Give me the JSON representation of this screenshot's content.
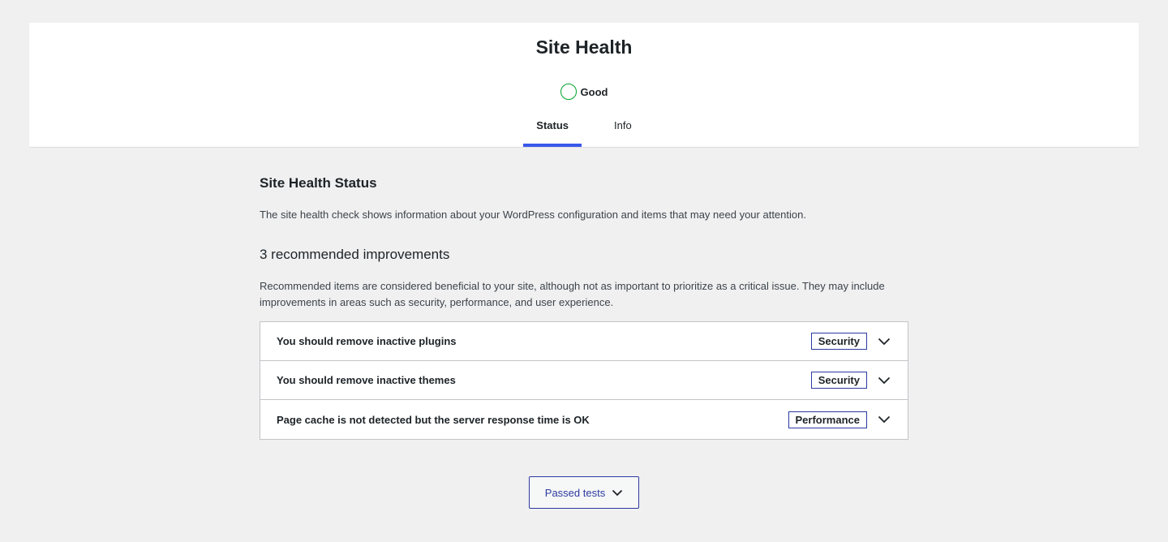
{
  "header": {
    "title": "Site Health",
    "status_label": "Good",
    "tabs": [
      {
        "label": "Status",
        "active": true
      },
      {
        "label": "Info",
        "active": false
      }
    ]
  },
  "status_section": {
    "title": "Site Health Status",
    "description": "The site health check shows information about your WordPress configuration and items that may need your attention."
  },
  "improvements": {
    "heading": "3 recommended improvements",
    "description": "Recommended items are considered beneficial to your site, although not as important to prioritize as a critical issue. They may include improvements in areas such as security, performance, and user experience.",
    "items": [
      {
        "title": "You should remove inactive plugins",
        "badge": "Security"
      },
      {
        "title": "You should remove inactive themes",
        "badge": "Security"
      },
      {
        "title": "Page cache is not detected but the server response time is OK",
        "badge": "Performance"
      }
    ]
  },
  "passed_tests": {
    "label": "Passed tests"
  },
  "colors": {
    "accent": "#3858e9",
    "good": "#00a32a",
    "badge_border": "#2c3ba0"
  }
}
